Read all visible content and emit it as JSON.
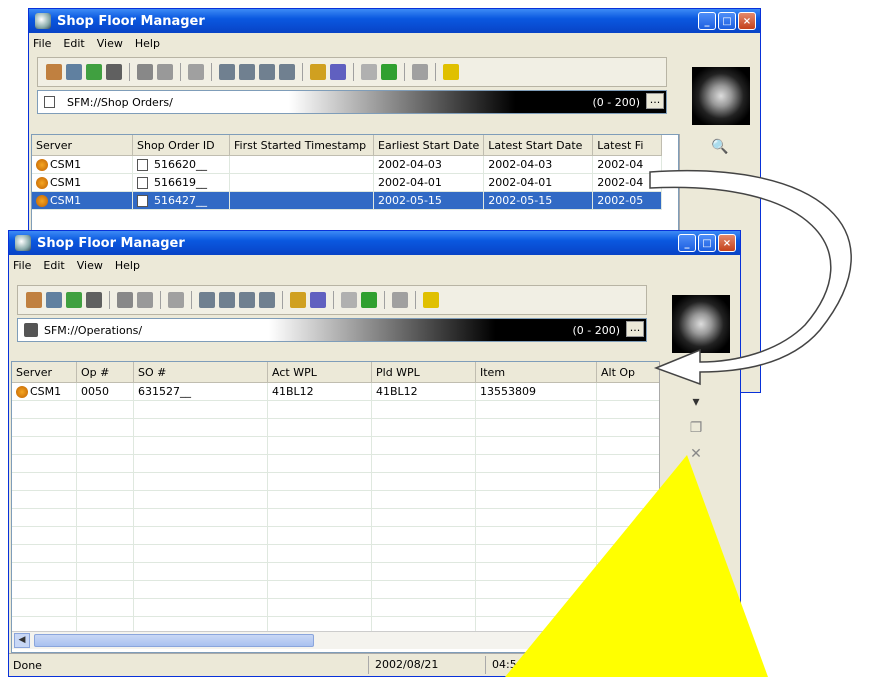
{
  "back_window": {
    "title": "Shop Floor Manager",
    "menu": [
      "File",
      "Edit",
      "View",
      "Help"
    ],
    "address": "SFM://Shop Orders/",
    "range": "(0 - 200)",
    "dots": "...",
    "columns": [
      "Server",
      "Shop Order ID",
      "First Started Timestamp",
      "Earliest Start Date",
      "Latest Start Date",
      "Latest Fi"
    ],
    "rows": [
      [
        "CSM1",
        "516620__",
        "",
        "2002-04-03",
        "2002-04-03",
        "2002-04"
      ],
      [
        "CSM1",
        "516619__",
        "",
        "2002-04-01",
        "2002-04-01",
        "2002-04"
      ],
      [
        "CSM1",
        "516427__",
        "",
        "2002-05-15",
        "2002-05-15",
        "2002-05"
      ]
    ]
  },
  "front_window": {
    "title": "Shop Floor Manager",
    "menu": [
      "File",
      "Edit",
      "View",
      "Help"
    ],
    "address": "SFM://Operations/",
    "range": "(0 - 200)",
    "dots": "...",
    "columns": [
      "Server",
      "Op #",
      "SO #",
      "Act WPL",
      "Pld WPL",
      "Item",
      "Alt Op"
    ],
    "rows": [
      [
        "CSM1",
        "0050",
        "631527__",
        "41BL12",
        "41BL12",
        "13553809",
        ""
      ]
    ],
    "status": {
      "text": "Done",
      "date": "2002/08/21",
      "time": "04:5"
    }
  },
  "colors": {
    "arrow_fill": "#ffff00",
    "selection": "#316ac5",
    "title_blue": "#0a58e0"
  }
}
